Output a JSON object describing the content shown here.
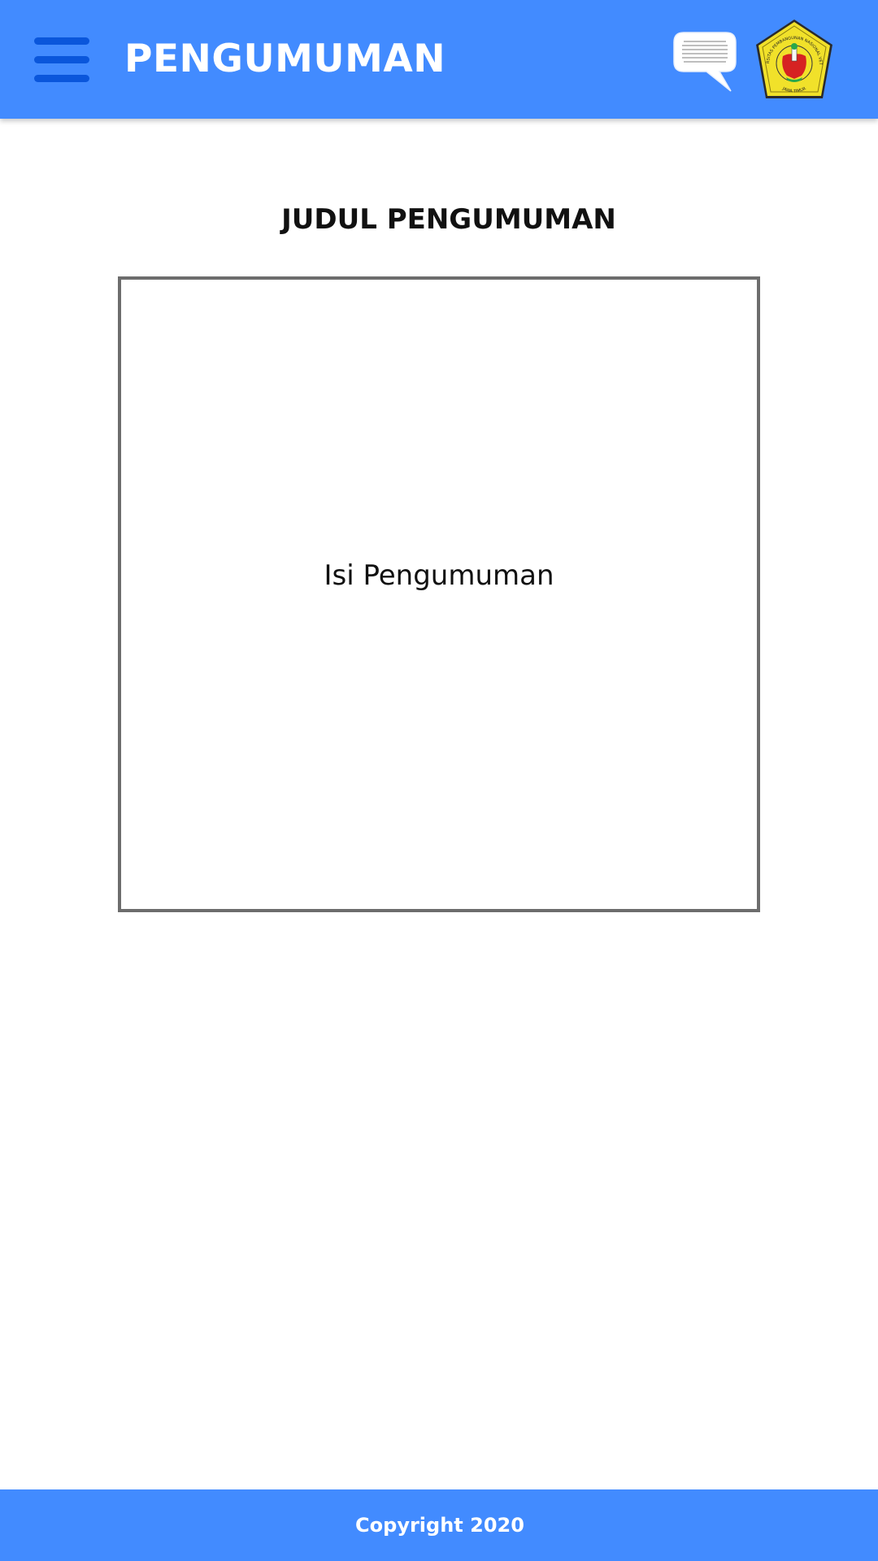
{
  "header": {
    "menu_icon": "hamburger-menu-icon",
    "title": "PENGUMUMAN",
    "chat_icon": "speech-bubble-icon",
    "logo_icon": "university-crest-logo",
    "logo_text_top": "UNIVERSITAS PEMBANGUNAN NASIONAL VETERAN",
    "logo_text_bottom": "JAWA TIMUR",
    "colors": {
      "bar": "#428bff",
      "menu": "#0a56db",
      "title": "#ffffff"
    }
  },
  "main": {
    "announcement_title": "JUDUL PENGUMUMAN",
    "announcement_body": "Isi Pengumuman"
  },
  "footer": {
    "copyright": "Copyright 2020"
  }
}
